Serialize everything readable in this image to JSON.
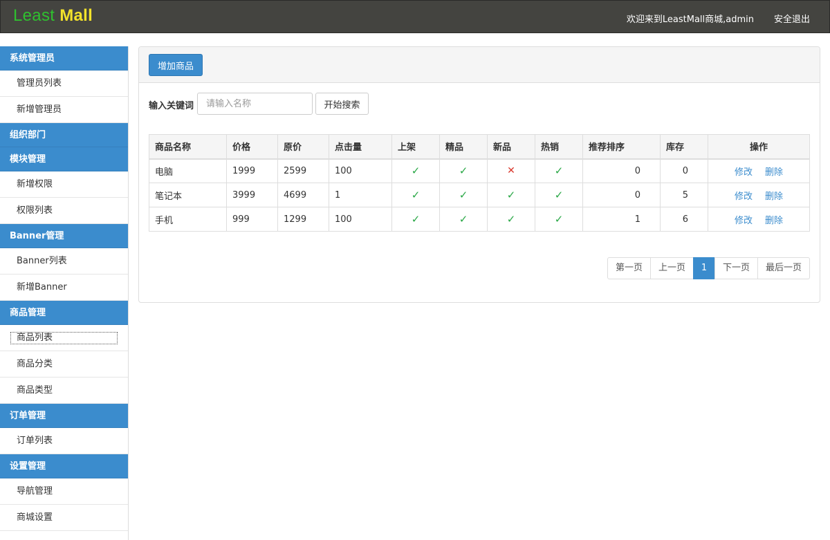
{
  "header": {
    "logo_part1": "Least",
    "logo_part2": "Mall",
    "welcome": "欢迎来到LeastMall商城,admin",
    "logout": "安全退出"
  },
  "sidebar": {
    "groups": [
      {
        "title": "系统管理员",
        "items": [
          "管理员列表",
          "新增管理员"
        ]
      },
      {
        "title": "组织部门",
        "items": []
      },
      {
        "title": "模块管理",
        "items": [
          "新增权限",
          "权限列表"
        ]
      },
      {
        "title": "Banner管理",
        "items": [
          "Banner列表",
          "新增Banner"
        ]
      },
      {
        "title": "商品管理",
        "items": [
          "商品列表",
          "商品分类",
          "商品类型"
        ]
      },
      {
        "title": "订单管理",
        "items": [
          "订单列表"
        ]
      },
      {
        "title": "设置管理",
        "items": [
          "导航管理",
          "商城设置"
        ]
      }
    ],
    "active_item": "商品列表"
  },
  "toolbar": {
    "add_label": "增加商品"
  },
  "search": {
    "label": "输入关键词",
    "placeholder": "请输入名称",
    "value": "",
    "button": "开始搜索"
  },
  "table": {
    "headers": [
      "商品名称",
      "价格",
      "原价",
      "点击量",
      "上架",
      "精品",
      "新品",
      "热销",
      "推荐排序",
      "库存",
      "操作"
    ],
    "rows": [
      {
        "name": "电脑",
        "price": "1999",
        "original": "2599",
        "clicks": "100",
        "on_shelf": true,
        "featured": true,
        "is_new": false,
        "hot": true,
        "sort": "0",
        "stock": "0"
      },
      {
        "name": "笔记本",
        "price": "3999",
        "original": "4699",
        "clicks": "1",
        "on_shelf": true,
        "featured": true,
        "is_new": true,
        "hot": true,
        "sort": "0",
        "stock": "5"
      },
      {
        "name": "手机",
        "price": "999",
        "original": "1299",
        "clicks": "100",
        "on_shelf": true,
        "featured": true,
        "is_new": true,
        "hot": true,
        "sort": "1",
        "stock": "6"
      }
    ],
    "actions": {
      "edit": "修改",
      "delete": "删除"
    },
    "icons": {
      "yes": "check-icon",
      "no": "cross-icon"
    },
    "colors": {
      "yes": "#28a745",
      "no": "#d9372c"
    }
  },
  "pagination": {
    "first": "第一页",
    "prev": "上一页",
    "current": "1",
    "next": "下一页",
    "last": "最后一页"
  },
  "colors": {
    "header_bg": "#444440",
    "accent": "#3b8ccd",
    "logo_green": "#2fc02f",
    "logo_yellow": "#f3e22b"
  }
}
